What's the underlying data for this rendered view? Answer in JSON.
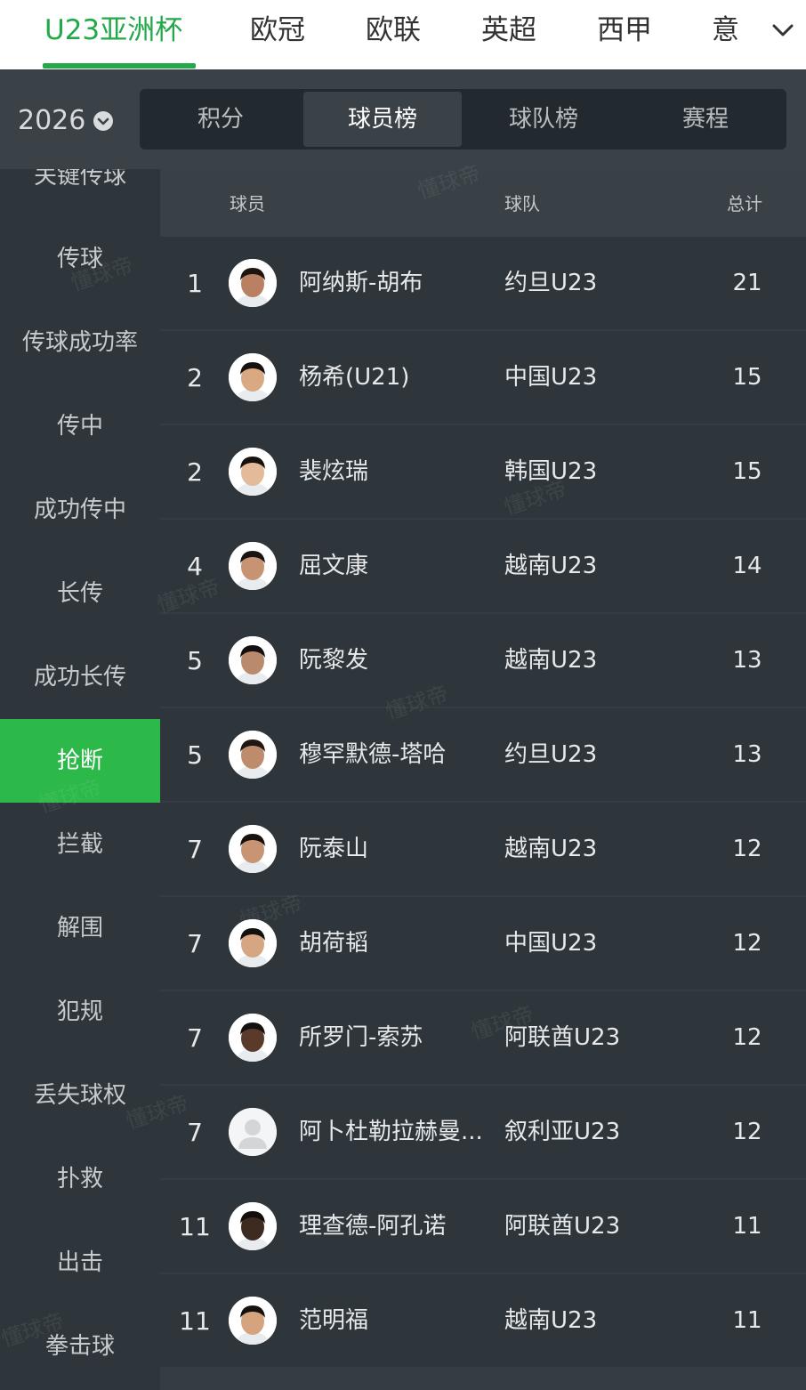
{
  "leagues": {
    "items": [
      "U23亚洲杯",
      "欧冠",
      "欧联",
      "英超",
      "西甲",
      "意"
    ],
    "active_index": 0
  },
  "season": {
    "label": "2026",
    "icon": "chevron-down-circle-icon"
  },
  "subtabs": {
    "items": [
      "积分",
      "球员榜",
      "球队榜",
      "赛程"
    ],
    "active_index": 1
  },
  "sidebar": {
    "items": [
      "关键传球",
      "传球",
      "传球成功率",
      "传中",
      "成功传中",
      "长传",
      "成功长传",
      "抢断",
      "拦截",
      "解围",
      "犯规",
      "丢失球权",
      "扑救",
      "出击",
      "拳击球"
    ],
    "active_index": 7
  },
  "table": {
    "headers": {
      "player": "球员",
      "team": "球队",
      "total": "总计"
    },
    "rows": [
      {
        "rank": "1",
        "name": "阿纳斯-胡布",
        "team": "约旦U23",
        "total": "21",
        "skin": "#b98063",
        "hair": "#1e1510"
      },
      {
        "rank": "2",
        "name": "杨希(U21)",
        "team": "中国U23",
        "total": "15",
        "skin": "#d8a983",
        "hair": "#16110d"
      },
      {
        "rank": "2",
        "name": "裴炫瑞",
        "team": "韩国U23",
        "total": "15",
        "skin": "#e3bb9a",
        "hair": "#17120e"
      },
      {
        "rank": "4",
        "name": "屈文康",
        "team": "越南U23",
        "total": "14",
        "skin": "#c69472",
        "hair": "#1a1411"
      },
      {
        "rank": "5",
        "name": "阮黎发",
        "team": "越南U23",
        "total": "13",
        "skin": "#b98a6b",
        "hair": "#141010"
      },
      {
        "rank": "5",
        "name": "穆罕默德-塔哈",
        "team": "约旦U23",
        "total": "13",
        "skin": "#bd8c6c",
        "hair": "#201712"
      },
      {
        "rank": "7",
        "name": "阮泰山",
        "team": "越南U23",
        "total": "12",
        "skin": "#c99473",
        "hair": "#161210"
      },
      {
        "rank": "7",
        "name": "胡荷韬",
        "team": "中国U23",
        "total": "12",
        "skin": "#d6a582",
        "hair": "#14100e"
      },
      {
        "rank": "7",
        "name": "所罗门-索苏",
        "team": "阿联酋U23",
        "total": "12",
        "skin": "#5a3a2a",
        "hair": "#151010"
      },
      {
        "rank": "7",
        "name": "阿卜杜勒拉赫曼...",
        "team": "叙利亚U23",
        "total": "12",
        "skin": "",
        "hair": ""
      },
      {
        "rank": "11",
        "name": "理查德-阿孔诺",
        "team": "阿联酋U23",
        "total": "11",
        "skin": "#3d2a20",
        "hair": "#120e0c"
      },
      {
        "rank": "11",
        "name": "范明福",
        "team": "越南U23",
        "total": "11",
        "skin": "#d5a47f",
        "hair": "#15110e"
      }
    ]
  },
  "watermark": {
    "text": "懂球帝"
  },
  "colors": {
    "accent": "#23a84a",
    "sidebar_active": "#2db84a"
  }
}
